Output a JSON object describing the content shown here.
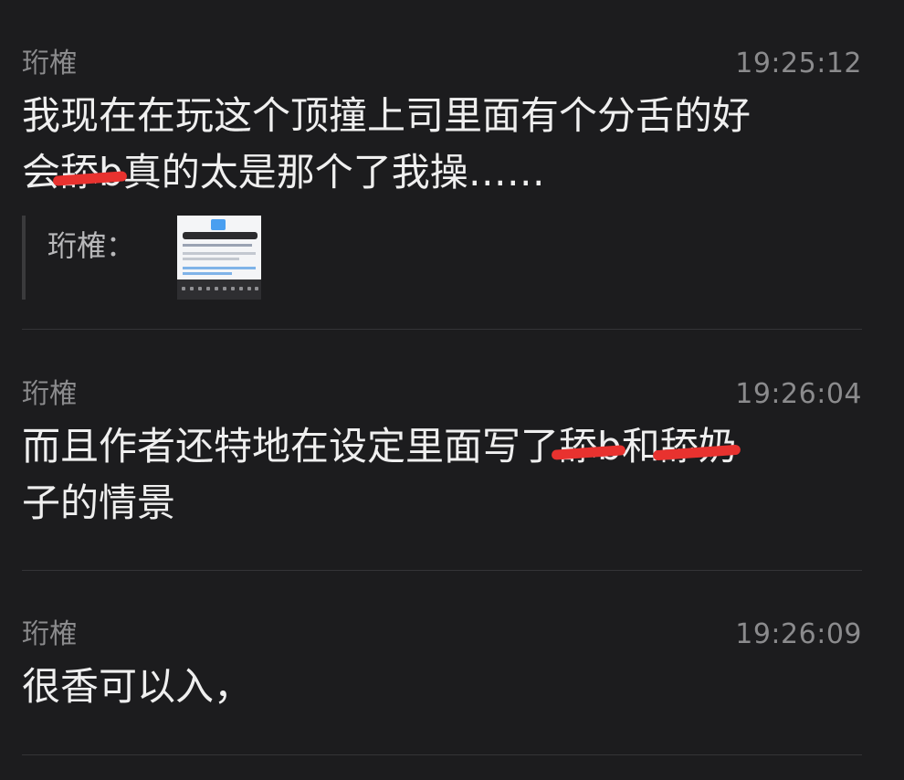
{
  "messages": [
    {
      "sender": "珩榷",
      "time": "19:25:12",
      "line1": "我现在在玩这个顶撞上司里面有个分舌的好",
      "line2_pre": "会",
      "line2_redacted": "舔b",
      "line2_post": "真的太是那个了我操……",
      "quote": {
        "name": "珩榷："
      }
    },
    {
      "sender": "珩榷",
      "time": "19:26:04",
      "line1_pre": "而且作者还特地在设定里面写了",
      "line1_redacted1": "舔b",
      "line1_mid": "和",
      "line1_redacted2": "舔奶",
      "line2": "子的情景"
    },
    {
      "sender": "珩榷",
      "time": "19:26:09",
      "line1": "很香可以入，"
    }
  ],
  "colors": {
    "background": "#1c1c1e",
    "meta_text": "#8b8b8d",
    "body_text": "#efefef",
    "redaction": "#e8322f",
    "divider": "#343437"
  }
}
